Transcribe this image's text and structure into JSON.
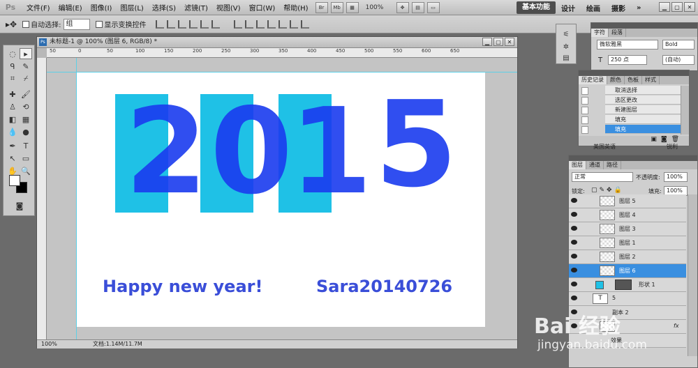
{
  "app": {
    "logo": "Ps"
  },
  "menu": {
    "items": [
      "文件(F)",
      "编辑(E)",
      "图像(I)",
      "图层(L)",
      "选择(S)",
      "滤镜(T)",
      "视图(V)",
      "窗口(W)",
      "帮助(H)"
    ]
  },
  "menubar_controls": {
    "br": "Br",
    "mb": "Mb",
    "zoom": "100%"
  },
  "workspace": {
    "items": [
      "基本功能",
      "设计",
      "绘画",
      "摄影"
    ],
    "more": "»"
  },
  "options": {
    "auto_select": "自动选择:",
    "group_value": "组",
    "show_transform": "显示变换控件"
  },
  "document": {
    "tab_title": "未标题-1 @ 100% (图层 6, RGB/8) *",
    "ruler_marks": [
      "50",
      "0",
      "50",
      "100",
      "150",
      "200",
      "250",
      "300",
      "350",
      "400",
      "450",
      "500",
      "550",
      "600",
      "650"
    ],
    "digits": [
      "2",
      "0",
      "1",
      "5"
    ],
    "caption_left": "Happy new year!",
    "caption_right": "Sara20140726",
    "status_zoom": "100%",
    "status_doc": "文档:1.14M/11.7M"
  },
  "char_panel": {
    "tabs": [
      "字符",
      "段落"
    ],
    "font_family": "微软雅黑",
    "font_style": "Bold",
    "font_size": "250 点",
    "leading": "(自动)",
    "language": "美国英语",
    "antialias": "锐利"
  },
  "history_panel": {
    "tabs": [
      "历史记录",
      "颜色",
      "色板",
      "样式"
    ],
    "items": [
      "取消选择",
      "选区更改",
      "新建图层",
      "填充",
      "填充"
    ]
  },
  "layers_panel": {
    "tabs": [
      "图层",
      "通道",
      "路径"
    ],
    "blend_mode": "正常",
    "opacity_label": "不透明度:",
    "opacity": "100%",
    "lock_label": "锁定:",
    "fill_label": "填充:",
    "fill": "100%",
    "layers": [
      "图层 5",
      "图层 4",
      "图层 3",
      "图层 1",
      "图层 2",
      "图层 6",
      "形状 1",
      "5",
      "副本 2",
      "效果"
    ]
  },
  "watermark": {
    "brand": "Bai 经验",
    "url": "jingyan.baidu.com"
  }
}
